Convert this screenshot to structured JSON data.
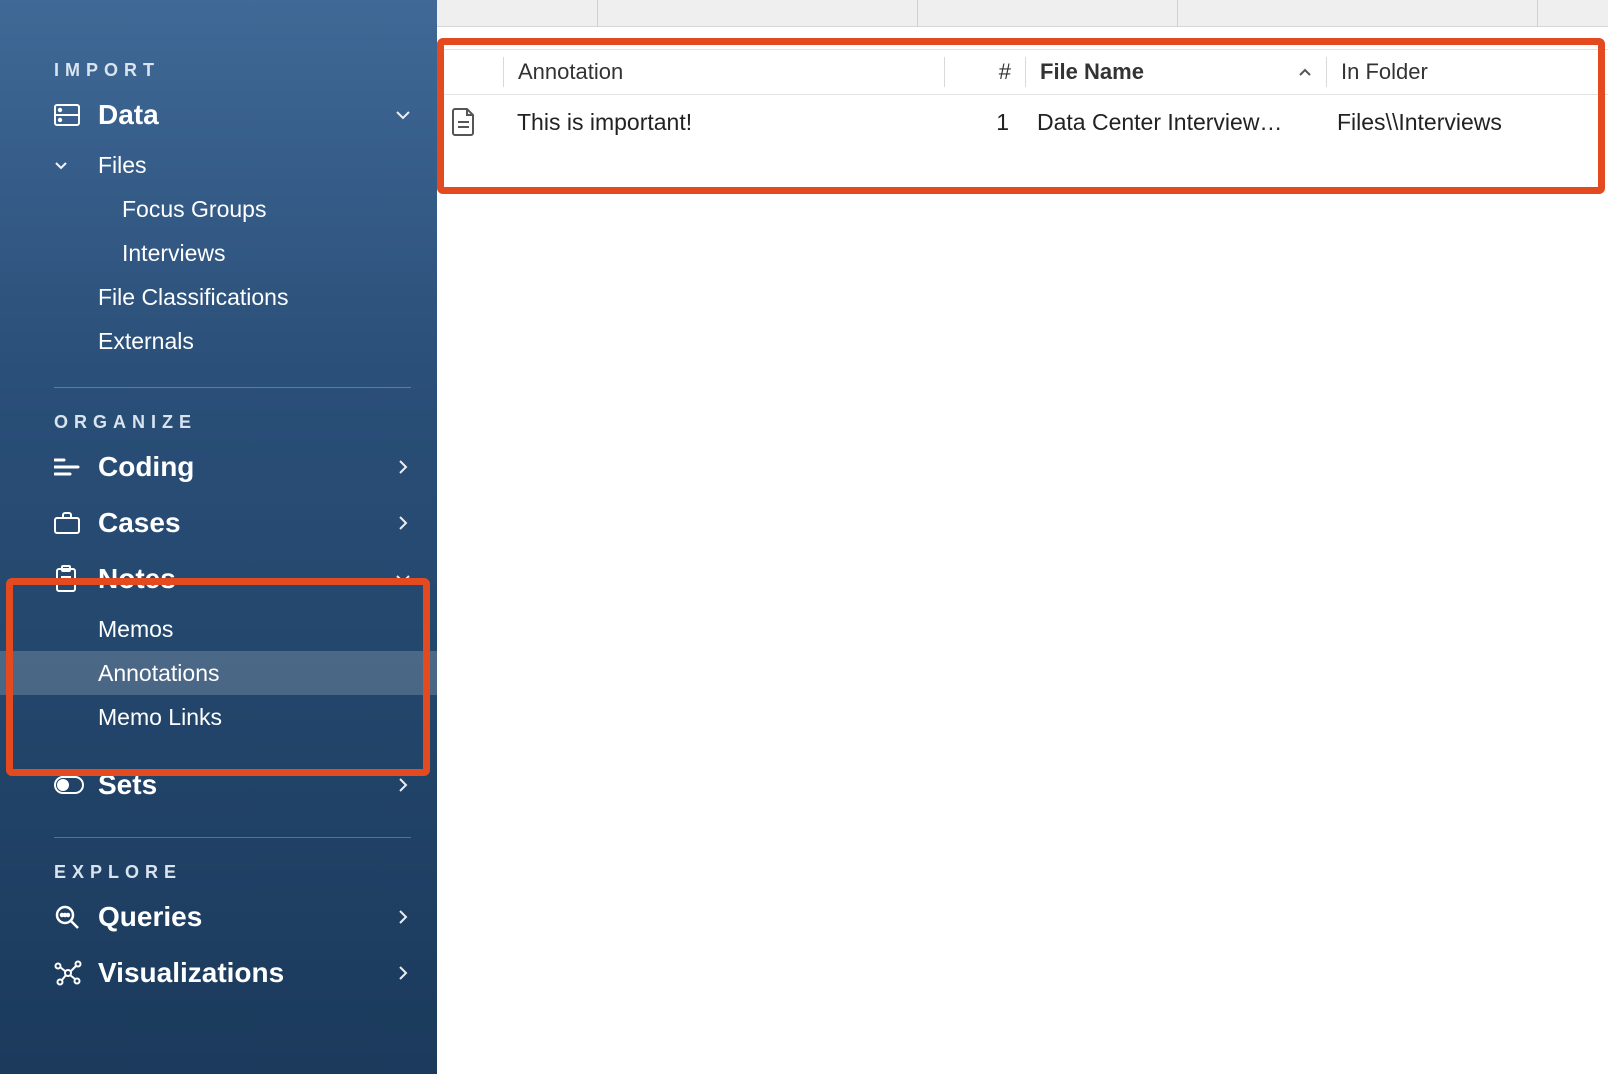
{
  "sidebar": {
    "sections": {
      "import": {
        "label": "IMPORT"
      },
      "organize": {
        "label": "ORGANIZE"
      },
      "explore": {
        "label": "EXPLORE"
      }
    },
    "data": {
      "label": "Data",
      "files": {
        "label": "Files",
        "children": {
          "focus_groups": "Focus Groups",
          "interviews": "Interviews"
        }
      },
      "file_classifications": "File Classifications",
      "externals": "Externals"
    },
    "coding": {
      "label": "Coding"
    },
    "cases": {
      "label": "Cases"
    },
    "notes": {
      "label": "Notes",
      "memos": "Memos",
      "annotations": "Annotations",
      "memo_links": "Memo Links"
    },
    "sets": {
      "label": "Sets"
    },
    "queries": {
      "label": "Queries"
    },
    "visualizations": {
      "label": "Visualizations"
    }
  },
  "table": {
    "headers": {
      "annotation": "Annotation",
      "hash": "#",
      "file_name": "File Name",
      "in_folder": "In Folder"
    },
    "rows": [
      {
        "annotation": "This is important!",
        "hash": "1",
        "file_name": "Data Center Interview…",
        "in_folder": "Files\\\\Interviews"
      }
    ]
  }
}
